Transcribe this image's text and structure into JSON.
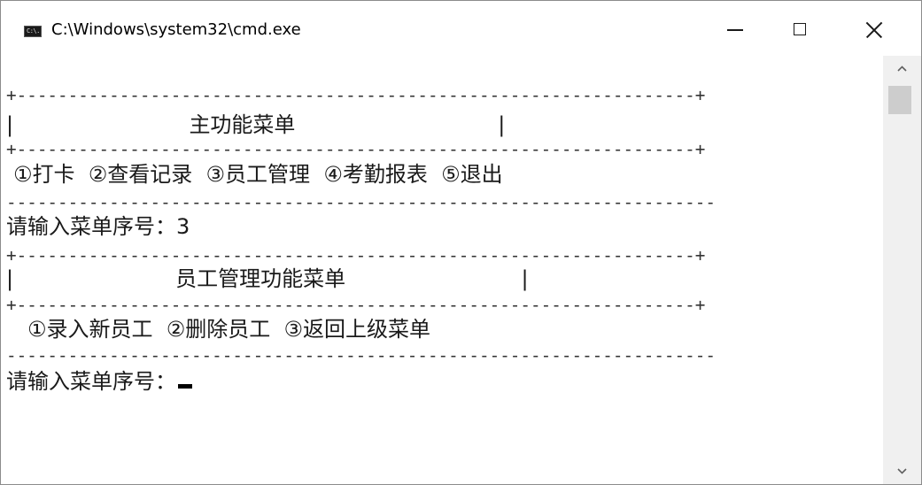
{
  "window": {
    "title": "C:\\Windows\\system32\\cmd.exe",
    "icon": "cmd-app-icon",
    "icon_text": "C:\\."
  },
  "controls": {
    "minimize": "minimize-icon",
    "maximize": "maximize-icon",
    "close": "close-icon"
  },
  "console": {
    "lines": [
      "+------------------------------------------------------------------+",
      "|                          主功能菜单                              |",
      "+------------------------------------------------------------------+",
      "①打卡  ②查看记录  ③员工管理  ④考勤报表  ⑤退出",
      "---------------------------------------------------------------------",
      "请输入菜单序号：3",
      "+------------------------------------------------------------------+",
      "|                        员工管理功能菜单                          |",
      "+------------------------------------------------------------------+",
      "①录入新员工  ②删除员工  ③返回上级菜单",
      "---------------------------------------------------------------------",
      "请输入菜单序号："
    ]
  },
  "scrollbar": {
    "up": "chevron-up-icon",
    "down": "chevron-down-icon"
  },
  "colors": {
    "background": "#ffffff",
    "text": "#1a1a1a",
    "scrollbar_track": "#f0f0f0",
    "scrollbar_thumb": "#cdcdcd"
  }
}
